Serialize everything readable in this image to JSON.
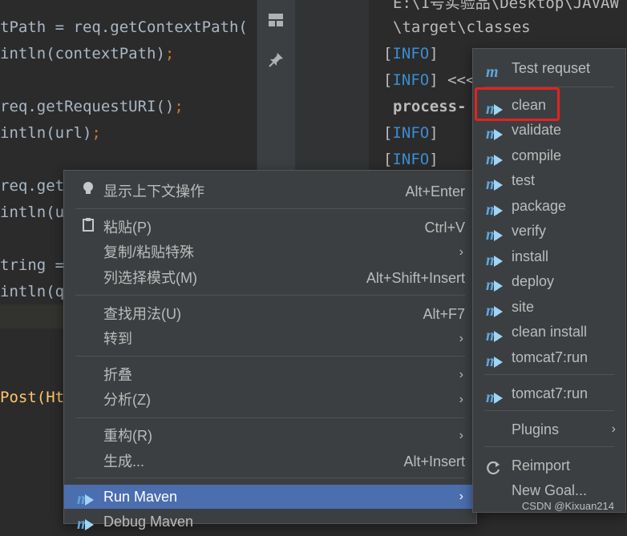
{
  "editor": {
    "lines": [
      {
        "text": "tPath = req.getContextPath(",
        "suffix": ""
      },
      {
        "text": "intln(contextPath)",
        "suffix": ";"
      },
      {
        "text": "req.getRequestURI()",
        "suffix": ";"
      },
      {
        "text": "intln(url)",
        "suffix": ";"
      },
      {
        "text": "req.get",
        "suffix": ""
      },
      {
        "text": "intln(u",
        "suffix": ""
      },
      {
        "text": "tring = ",
        "suffix": ""
      },
      {
        "text": "intln(q",
        "suffix": ""
      },
      {
        "text": "Post(Ht",
        "suffix": ""
      }
    ]
  },
  "console": {
    "line1": "E:\\1号实验品\\Desktop\\JAVAW",
    "line2": "\\target\\classes",
    "info_tag": "INFO",
    "line4_suffix": " <<<",
    "line5": "process-",
    "left_bracket": "[",
    "right_bracket": "]"
  },
  "toolstrip": {
    "icons": [
      "layout-icon",
      "pin-icon"
    ]
  },
  "context_menu": {
    "show_actions": {
      "label": "显示上下文操作",
      "shortcut": "Alt+Enter"
    },
    "paste": {
      "label": "粘贴(P)",
      "shortcut": "Ctrl+V"
    },
    "copy_paste_special": {
      "label": "复制/粘贴特殊"
    },
    "column_select": {
      "label": "列选择模式(M)",
      "shortcut": "Alt+Shift+Insert"
    },
    "find_usages": {
      "label": "查找用法(U)",
      "shortcut": "Alt+F7"
    },
    "goto": {
      "label": "转到"
    },
    "fold": {
      "label": "折叠"
    },
    "analyze": {
      "label": "分析(Z)"
    },
    "refactor": {
      "label": "重构(R)"
    },
    "generate": {
      "label": "生成...",
      "shortcut": "Alt+Insert"
    },
    "run_maven": {
      "label": "Run Maven"
    },
    "debug_maven": {
      "label": "Debug Maven"
    }
  },
  "submenu": {
    "items": [
      {
        "label": "Test requset"
      },
      {
        "label": "clean"
      },
      {
        "label": "validate"
      },
      {
        "label": "compile"
      },
      {
        "label": "test"
      },
      {
        "label": "package"
      },
      {
        "label": "verify"
      },
      {
        "label": "install"
      },
      {
        "label": "deploy"
      },
      {
        "label": "site"
      },
      {
        "label": "clean install"
      },
      {
        "label": "tomcat7:run"
      }
    ],
    "tomcat_run_2": "tomcat7:run",
    "plugins": "Plugins",
    "reimport": "Reimport",
    "new_goal": "New Goal..."
  },
  "watermark": "CSDN @Kixuan214",
  "colors": {
    "accent": "#4b6eaf",
    "highlight_box": "#e32222",
    "info": "#3c8cd3",
    "maven_icon": "#5ea6dd"
  }
}
